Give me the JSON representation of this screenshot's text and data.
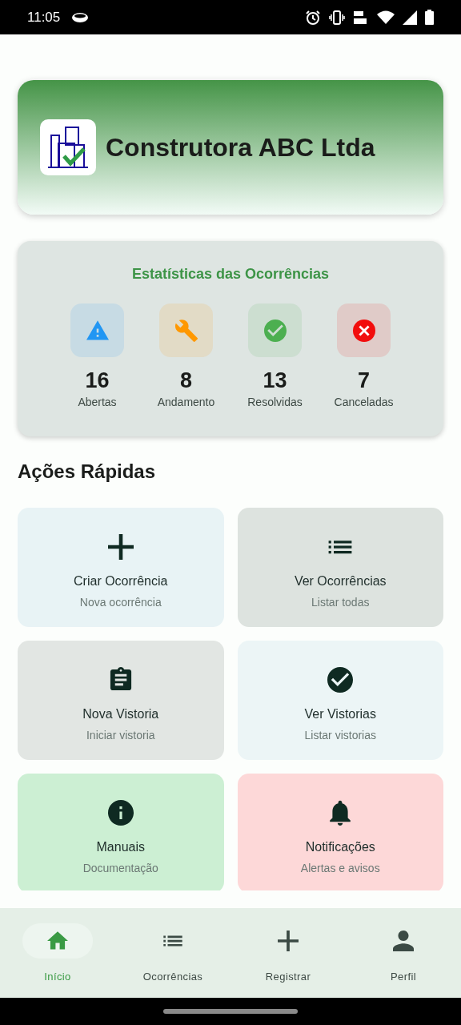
{
  "status_bar": {
    "time": "11:05"
  },
  "header": {
    "company": "Construtora ABC Ltda"
  },
  "stats": {
    "title": "Estatísticas das Ocorrências",
    "items": [
      {
        "kind": "warning",
        "value": "16",
        "label": "Abertas",
        "color": "#2196f3"
      },
      {
        "kind": "wrench",
        "value": "8",
        "label": "Andamento",
        "color": "#ff9800"
      },
      {
        "kind": "check",
        "value": "13",
        "label": "Resolvidas",
        "color": "#4caf50"
      },
      {
        "kind": "cancel",
        "value": "7",
        "label": "Canceladas",
        "color": "#f20d0d"
      }
    ]
  },
  "quick_actions": {
    "title": "Ações Rápidas",
    "items": [
      {
        "kind": "plus",
        "title": "Criar Ocorrência",
        "subtitle": "Nova ocorrência",
        "color": "#e8f3f5"
      },
      {
        "kind": "list",
        "title": "Ver Ocorrências",
        "subtitle": "Listar todas",
        "color": "#dde3df"
      },
      {
        "kind": "clipboard",
        "title": "Nova Vistoria",
        "subtitle": "Iniciar vistoria",
        "color": "#e2e6e3"
      },
      {
        "kind": "check",
        "title": "Ver Vistorias",
        "subtitle": "Listar vistorias",
        "color": "#ecf5f6"
      },
      {
        "kind": "info",
        "title": "Manuais",
        "subtitle": "Documentação",
        "color": "#ccefd3"
      },
      {
        "kind": "bell",
        "title": "Notificações",
        "subtitle": "Alertas e avisos",
        "color": "#fdd8d8"
      }
    ]
  },
  "nav": [
    {
      "kind": "home",
      "label": "Início",
      "selected": true
    },
    {
      "kind": "list",
      "label": "Ocorrências",
      "selected": false
    },
    {
      "kind": "plus",
      "label": "Registrar",
      "selected": false
    },
    {
      "kind": "person",
      "label": "Perfil",
      "selected": false
    }
  ]
}
